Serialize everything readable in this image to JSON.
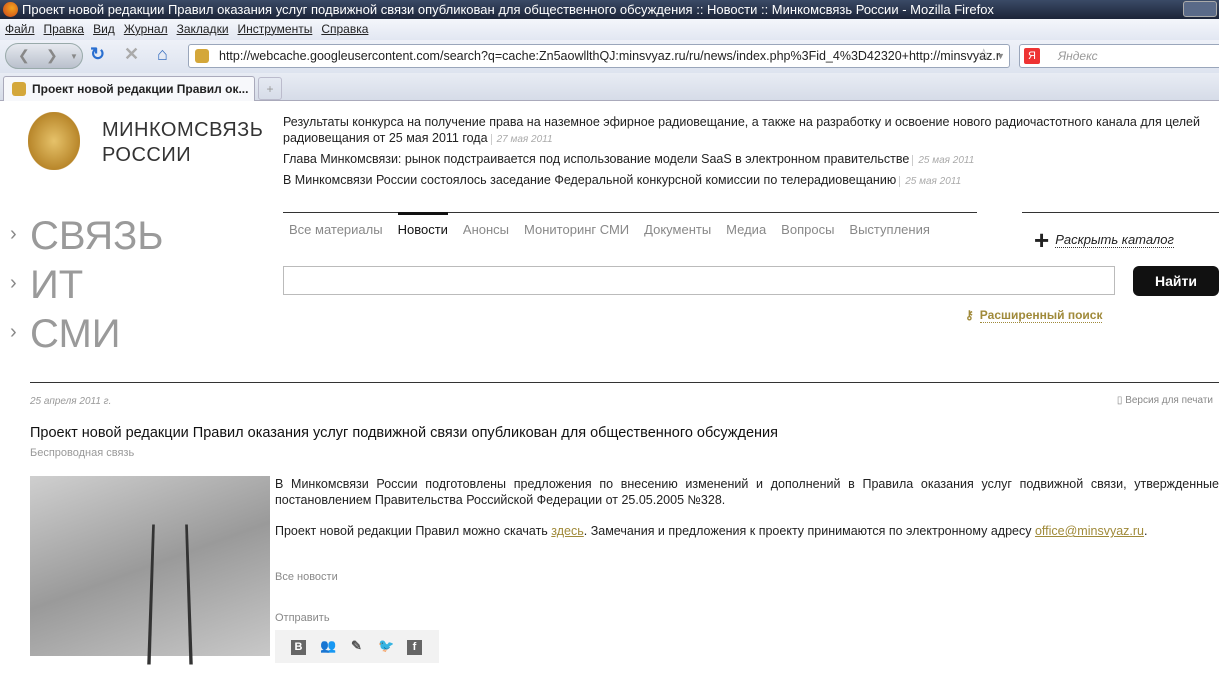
{
  "window": {
    "title": "Проект новой редакции Правил оказания услуг подвижной связи опубликован для общественного обсуждения :: Новости :: Минкомсвязь России - Mozilla Firefox"
  },
  "menu": [
    "Файл",
    "Правка",
    "Вид",
    "Журнал",
    "Закладки",
    "Инструменты",
    "Справка"
  ],
  "url": "http://webcache.googleusercontent.com/search?q=cache:Zn5aowllthQJ:minsvyaz.ru/ru/news/index.php%3Fid_4%3D42320+http://minsvyaz.r",
  "search_placeholder": "Яндекс",
  "tab": {
    "label": "Проект новой редакции Правил ок...",
    "new": "+"
  },
  "logo": {
    "line1": "МИНКОМСВЯЗЬ",
    "line2": "РОССИИ"
  },
  "headlines": [
    {
      "text": "Результаты конкурса на получение права на наземное эфирное радиовещание, а также на разработку и освоение нового радиочастотного канала для целей радиовещания от 25 мая 2011 года",
      "date": "27 мая 2011"
    },
    {
      "text": "Глава Минкомсвязи: рынок подстраивается под использование модели SaaS в электронном правительстве",
      "date": "25 мая 2011"
    },
    {
      "text": "В Минкомсвязи России состоялось заседание Федеральной конкурсной комиссии по телерадиовещанию",
      "date": "25 мая 2011"
    }
  ],
  "sections": [
    "СВЯЗЬ",
    "ИТ",
    "СМИ"
  ],
  "nav_tabs": [
    "Все материалы",
    "Новости",
    "Анонсы",
    "Мониторинг СМИ",
    "Документы",
    "Медиа",
    "Вопросы",
    "Выступления"
  ],
  "catalog": "Раскрыть каталог",
  "search_button": "Найти",
  "advanced_search": "Расширенный поиск",
  "article": {
    "date": "25 апреля 2011 г.",
    "print": "Версия для печати",
    "title": "Проект новой редакции Правил оказания услуг подвижной связи опубликован для общественного обсуждения",
    "category": "Беспроводная связь",
    "p1": "В Минкомсвязи России подготовлены предложения по внесению изменений и дополнений в Правила оказания услуг подвижной связи, утвержденные постановлением Правительства Российской Федерации от 25.05.2005 №328.",
    "p2a": "Проект новой редакции Правил можно скачать ",
    "p2link": "здесь",
    "p2b": ". Замечания и предложения к проекту принимаются по электронному адресу ",
    "email": "office@minsvyaz.ru",
    "p2c": ".",
    "all_news": "Все новости",
    "send": "Отправить",
    "social": [
      "В",
      "f"
    ]
  }
}
